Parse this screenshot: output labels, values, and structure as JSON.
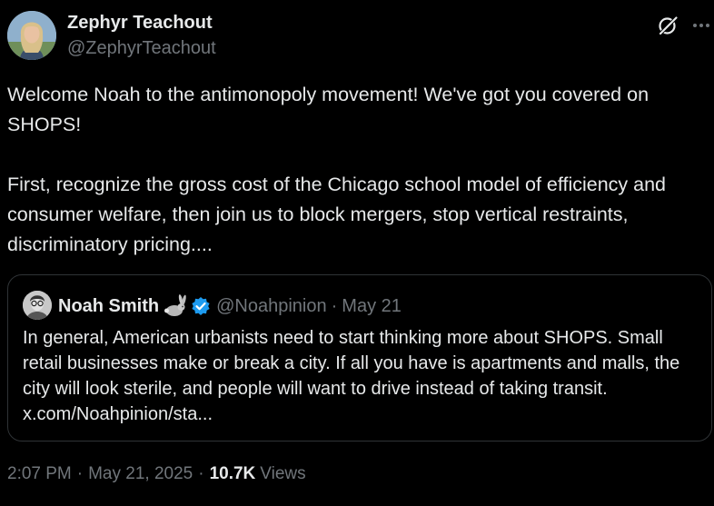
{
  "author": {
    "name": "Zephyr Teachout",
    "handle": "@ZephyrTeachout"
  },
  "icons": {
    "header": [
      "grok-icon",
      "more-icon"
    ],
    "quote": [
      "rabbit-emoji-icon",
      "verified-badge-icon"
    ]
  },
  "colors": {
    "background": "#000000",
    "text": "#e7e9ea",
    "muted": "#71767b",
    "border": "#2f3336",
    "verified": "#1d9bf0"
  },
  "post": {
    "paragraphs": [
      "Welcome Noah to the antimonopoly movement! We've got you covered on SHOPS!",
      "First, recognize the gross cost of the Chicago school model of efficiency and consumer welfare, then join us to block mergers, stop vertical restraints, discriminatory pricing...."
    ]
  },
  "quote": {
    "name": "Noah Smith",
    "handle": "@Noahpinion",
    "separator": "·",
    "date": "May 21",
    "text": "In general, American urbanists need to start thinking more about SHOPS. Small retail businesses make or break a city. If all you have is apartments and malls, the city will look sterile, and people will want to drive instead of taking transit. x.com/Noahpinion/sta..."
  },
  "meta": {
    "time": "2:07 PM",
    "separator": "·",
    "date": "May 21, 2025",
    "views_count": "10.7K",
    "views_label": "Views"
  }
}
